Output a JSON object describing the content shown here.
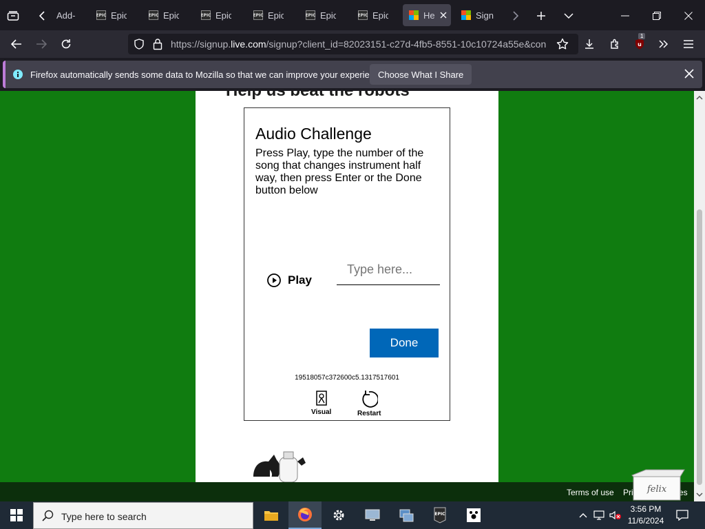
{
  "tabs": [
    {
      "label": "Add-",
      "favicon": "none"
    },
    {
      "label": "Epic",
      "favicon": "epic-games-icon"
    },
    {
      "label": "Epic",
      "favicon": "epic-games-icon"
    },
    {
      "label": "Epic",
      "favicon": "epic-games-icon"
    },
    {
      "label": "Epic",
      "favicon": "epic-games-icon"
    },
    {
      "label": "Epic",
      "favicon": "epic-games-icon"
    },
    {
      "label": "Epic",
      "favicon": "epic-games-icon"
    },
    {
      "label": "He",
      "favicon": "microsoft-icon",
      "active": true
    },
    {
      "label": "Sign",
      "favicon": "microsoft-icon"
    }
  ],
  "epic_logo_text": "EPIC",
  "url": {
    "prefix": "https://signup.",
    "domain": "live.com",
    "rest": "/signup?client_id=82023151-c27d-4fb5-8551-10c10724a55e&con"
  },
  "extension_badge": "1",
  "notification": {
    "text": "Firefox automatically sends some data to Mozilla so that we can improve your experience.",
    "button": "Choose What I Share"
  },
  "page": {
    "heading": "Help us beat the robots",
    "challenge_title": "Audio Challenge",
    "instructions": "Press Play, type the number of the song that changes instrument half way, then press Enter or the Done button below",
    "play_label": "Play",
    "answer_placeholder": "Type here...",
    "done_label": "Done",
    "token": "19518057c372600c5.1317517601",
    "switch_visual": "Visual",
    "switch_restart": "Restart"
  },
  "footer": {
    "terms": "Terms of use",
    "privacy": "Pri",
    "cookies": "es"
  },
  "taskbar": {
    "search_placeholder": "Type here to search",
    "time": "3:56 PM",
    "date": "11/6/2024"
  },
  "colors": {
    "page_background": "#107c10",
    "primary_button": "#0067b8",
    "notification_accent": "#bd7cd8"
  }
}
